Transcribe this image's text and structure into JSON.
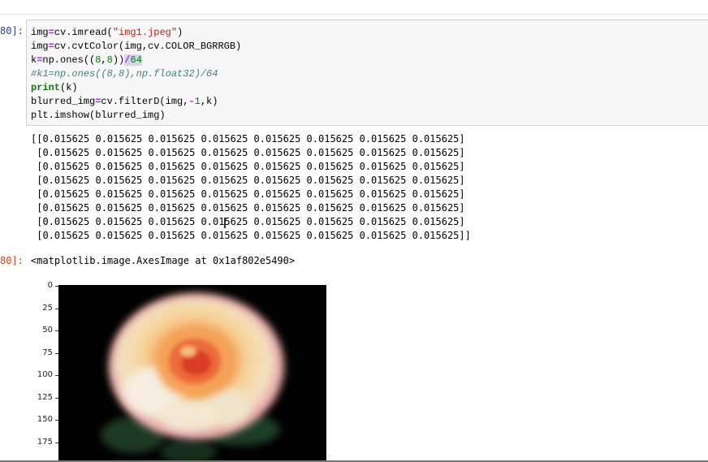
{
  "cell": {
    "input_prompt": "80]:",
    "output_prompt": "80]:",
    "code_lines": [
      "img=cv2.imread(\"img1.jpeg\")",
      "img=cv2.cvtColor(img,cv2.COLOR_BGR2RGB)",
      "k1=np.ones((8,8))/64",
      "#k1=np.ones((8,8),np.float32)/64",
      "print(k1)",
      "blurred_img=cv2.filter2D(img,-1,k1)",
      "plt.imshow(blurred_img)"
    ]
  },
  "stdout": {
    "lines": [
      "[[0.015625 0.015625 0.015625 0.015625 0.015625 0.015625 0.015625 0.015625]",
      " [0.015625 0.015625 0.015625 0.015625 0.015625 0.015625 0.015625 0.015625]",
      " [0.015625 0.015625 0.015625 0.015625 0.015625 0.015625 0.015625 0.015625]",
      " [0.015625 0.015625 0.015625 0.015625 0.015625 0.015625 0.015625 0.015625]",
      " [0.015625 0.015625 0.015625 0.015625 0.015625 0.015625 0.015625 0.015625]",
      " [0.015625 0.015625 0.015625 0.015625 0.015625 0.015625 0.015625 0.015625]",
      " [0.015625 0.015625 0.015625 0.015625 0.015625 0.015625 0.015625 0.015625]",
      " [0.015625 0.015625 0.015625 0.015625 0.015625 0.015625 0.015625 0.015625]]"
    ]
  },
  "result_text": "<matplotlib.image.AxesImage at 0x1af802e5490>",
  "plot": {
    "y_ticks": [
      "0",
      "25",
      "50",
      "75",
      "100",
      "125",
      "150",
      "175"
    ]
  },
  "colors": {
    "input_prompt": "#303f9f",
    "output_prompt": "#d84315",
    "cell_background": "#f7f7f7"
  }
}
